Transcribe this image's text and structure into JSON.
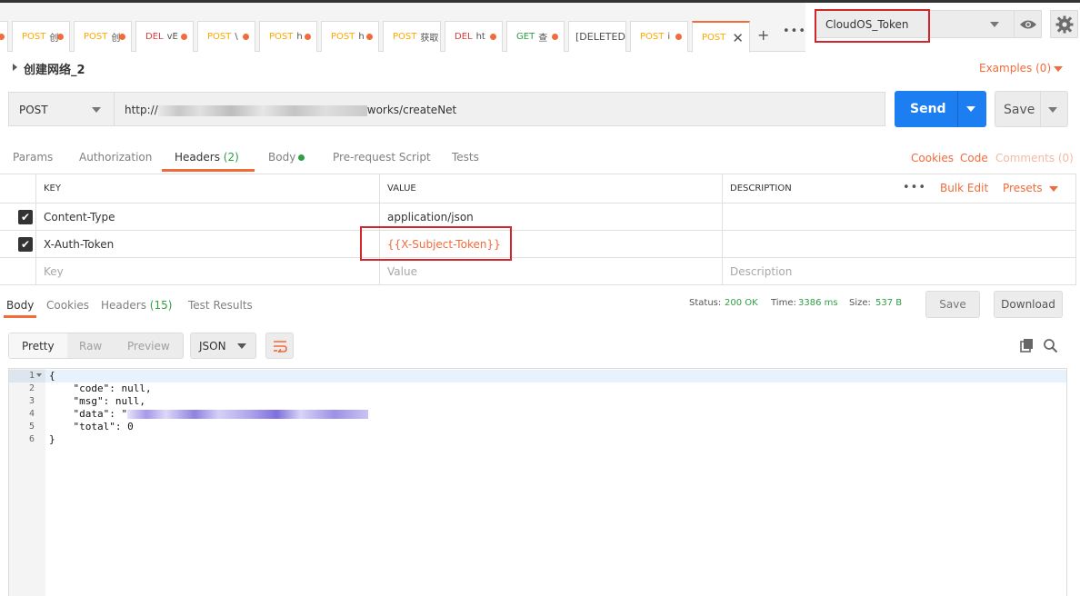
{
  "tabs": [
    {
      "method": "POST",
      "title": "创"
    },
    {
      "method": "POST",
      "title": "创"
    },
    {
      "method": "DEL",
      "title": "vE"
    },
    {
      "method": "POST",
      "title": "\\"
    },
    {
      "method": "POST",
      "title": "h"
    },
    {
      "method": "POST",
      "title": "h"
    },
    {
      "method": "POST",
      "title": "获取"
    },
    {
      "method": "DEL",
      "title": "ht"
    },
    {
      "method": "GET",
      "title": "查"
    },
    {
      "method": "",
      "title": "[DELETED]"
    },
    {
      "method": "POST",
      "title": "i"
    },
    {
      "method": "POST",
      "title": ""
    }
  ],
  "environment": {
    "selected": "CloudOS_Token"
  },
  "request": {
    "name": "创建网络_2",
    "examples_label": "Examples (0)",
    "method": "POST",
    "url_prefix": "http://",
    "url_suffix": "works/createNet",
    "send_label": "Send",
    "save_label": "Save"
  },
  "request_tabs": {
    "params": "Params",
    "authorization": "Authorization",
    "headers": "Headers",
    "headers_count": "(2)",
    "body": "Body",
    "prerequest": "Pre-request Script",
    "tests": "Tests",
    "cookies": "Cookies",
    "code": "Code",
    "comments": "Comments (0)"
  },
  "headers_table": {
    "col_key": "KEY",
    "col_value": "VALUE",
    "col_description": "DESCRIPTION",
    "bulk_edit": "Bulk Edit",
    "presets": "Presets",
    "rows": [
      {
        "key": "Content-Type",
        "value": "application/json"
      },
      {
        "key": "X-Auth-Token",
        "value": "{{X-Subject-Token}}"
      }
    ],
    "placeholder_key": "Key",
    "placeholder_value": "Value",
    "placeholder_description": "Description"
  },
  "response": {
    "tabs": {
      "body": "Body",
      "cookies": "Cookies",
      "headers": "Headers",
      "headers_count": "(15)",
      "test_results": "Test Results"
    },
    "status_label": "Status:",
    "status_value": "200 OK",
    "time_label": "Time:",
    "time_value": "3386 ms",
    "size_label": "Size:",
    "size_value": "537 B",
    "save_label": "Save",
    "download_label": "Download",
    "view_modes": {
      "pretty": "Pretty",
      "raw": "Raw",
      "preview": "Preview"
    },
    "format": "JSON",
    "code_lines": [
      {
        "n": "1",
        "text": "{"
      },
      {
        "n": "2",
        "text": "    \"code\": null,"
      },
      {
        "n": "3",
        "text": "    \"msg\": null,"
      },
      {
        "n": "4",
        "text": "    \"data\": \""
      },
      {
        "n": "5",
        "text": "    \"total\": 0"
      },
      {
        "n": "6",
        "text": "}"
      }
    ]
  },
  "colors": {
    "accent": "#f26b3a",
    "send": "#1d7ef2",
    "success": "#2f9e44",
    "highlight": "#d0262c"
  }
}
